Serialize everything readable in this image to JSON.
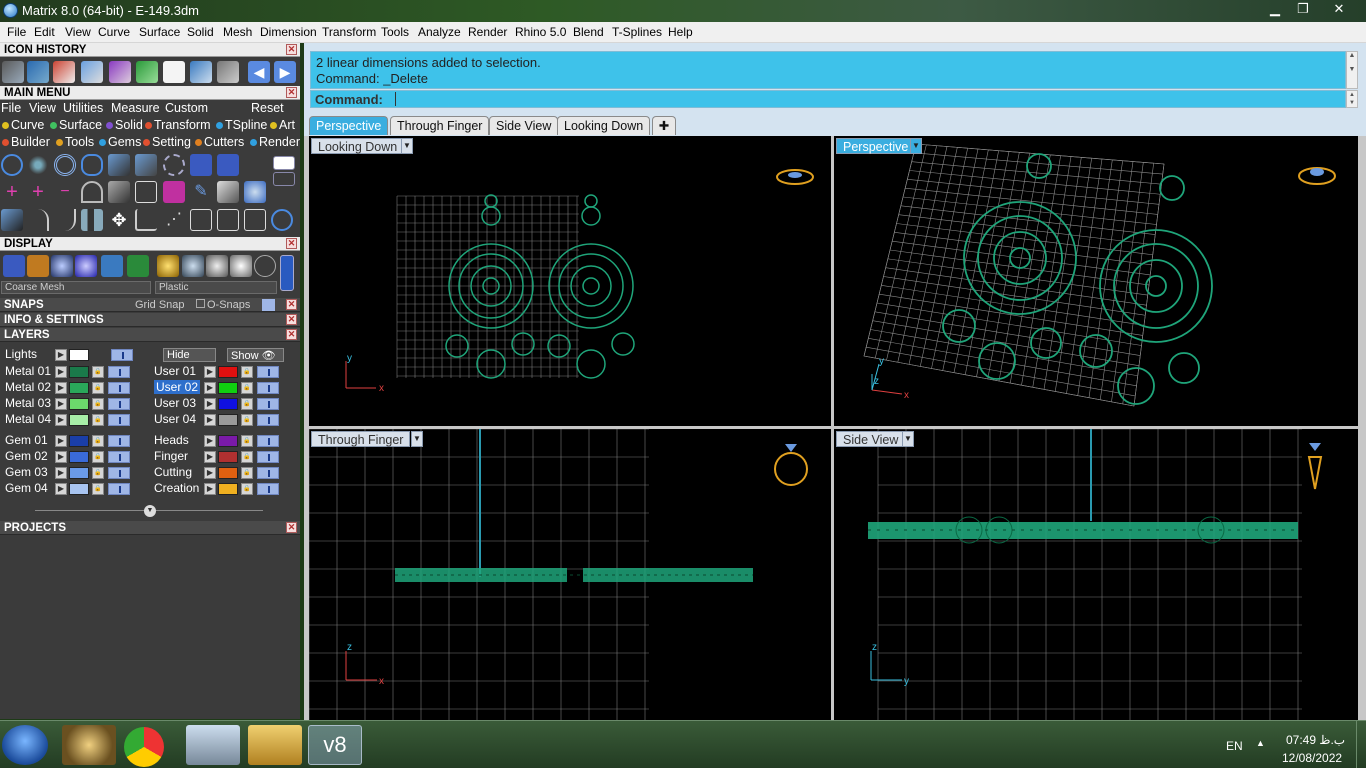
{
  "window": {
    "title": "Matrix 8.0 (64-bit) - E-149.3dm",
    "minimize": "▁",
    "maximize": "❐",
    "close": "✕"
  },
  "menubar": [
    "File",
    "Edit",
    "View",
    "Curve",
    "Surface",
    "Solid",
    "Mesh",
    "Dimension",
    "Transform",
    "Tools",
    "Analyze",
    "Render",
    "Rhino 5.0",
    "Blend",
    "T-Splines",
    "Help"
  ],
  "panels": {
    "icon_history": "ICON HISTORY",
    "main_menu": "MAIN MENU",
    "display": "DISPLAY",
    "snaps": "SNAPS",
    "info_settings": "INFO & SETTINGS",
    "layers": "LAYERS",
    "projects": "PROJECTS"
  },
  "main_menu": {
    "row1": [
      "File",
      "View",
      "Utilities",
      "Measure",
      "Custom",
      "Reset"
    ],
    "row2": [
      {
        "label": "Curve",
        "color": "#e0c020"
      },
      {
        "label": "Surface",
        "color": "#40c060"
      },
      {
        "label": "Solid",
        "color": "#8050d0"
      },
      {
        "label": "Transform",
        "color": "#e05030"
      },
      {
        "label": "TSpline",
        "color": "#30a0e0"
      },
      {
        "label": "Art",
        "color": "#e0c020"
      }
    ],
    "row3": [
      {
        "label": "Builder",
        "color": "#e05030"
      },
      {
        "label": "Tools",
        "color": "#e0a020"
      },
      {
        "label": "Gems",
        "color": "#30a0e0"
      },
      {
        "label": "Setting",
        "color": "#e05030"
      },
      {
        "label": "Cutters",
        "color": "#e08020"
      },
      {
        "label": "Render",
        "color": "#30a0e0"
      }
    ]
  },
  "display": {
    "mesh": "Coarse Mesh",
    "material": "Plastic"
  },
  "snaps": {
    "grid": "Grid Snap",
    "osnaps": "O-Snaps"
  },
  "layers": {
    "lights": "Lights",
    "hide": "Hide",
    "show": "Show",
    "left": [
      {
        "name": "Metal 01",
        "color": "#1a7a4a"
      },
      {
        "name": "Metal 02",
        "color": "#2aa85a"
      },
      {
        "name": "Metal 03",
        "color": "#6cd86c"
      },
      {
        "name": "Metal 04",
        "color": "#a8eea8"
      },
      {
        "name": "Gem 01",
        "color": "#1a3ea8"
      },
      {
        "name": "Gem 02",
        "color": "#3a6ad8"
      },
      {
        "name": "Gem 03",
        "color": "#6a9ae8"
      },
      {
        "name": "Gem 04",
        "color": "#a8c4f0"
      }
    ],
    "right": [
      {
        "name": "User 01",
        "color": "#e01010"
      },
      {
        "name": "User 02",
        "color": "#10d010"
      },
      {
        "name": "User 03",
        "color": "#1010e0"
      },
      {
        "name": "User 04",
        "color": "#9a9a9a"
      },
      {
        "name": "Heads",
        "color": "#7a1aa8"
      },
      {
        "name": "Finger",
        "color": "#b03030"
      },
      {
        "name": "Cutting",
        "color": "#e06010"
      },
      {
        "name": "Creation",
        "color": "#f0b020"
      }
    ]
  },
  "command": {
    "history": [
      "2 linear dimensions added to selection.",
      "Command: _Delete"
    ],
    "prompt": "Command:",
    "value": ""
  },
  "tabs": [
    {
      "label": "Perspective",
      "active": true
    },
    {
      "label": "Through Finger",
      "active": false
    },
    {
      "label": "Side View",
      "active": false
    },
    {
      "label": "Looking Down",
      "active": false
    }
  ],
  "tab_add": "✚",
  "viewports": {
    "top_left": {
      "label": "Looking Down",
      "axes": [
        "y",
        "x"
      ]
    },
    "top_right": {
      "label": "Perspective",
      "axes": [
        "y",
        "z",
        "x"
      ]
    },
    "bottom_left": {
      "label": "Through Finger",
      "axes": [
        "z",
        "x"
      ]
    },
    "bottom_right": {
      "label": "Side View",
      "axes": [
        "z",
        "y"
      ]
    }
  },
  "taskbar": {
    "lang": "EN",
    "time": "07:49 ب.ظ",
    "date": "12/08/2022",
    "apps": [
      "start-orb",
      "paint-icon",
      "chrome-icon",
      "calculator-icon",
      "explorer-icon",
      "matrix-icon"
    ],
    "active_app_label": "v8"
  },
  "colors": {
    "jewelry": "#1fa57a",
    "grid": "#8a8a8a",
    "accent": "#3aaee0"
  }
}
